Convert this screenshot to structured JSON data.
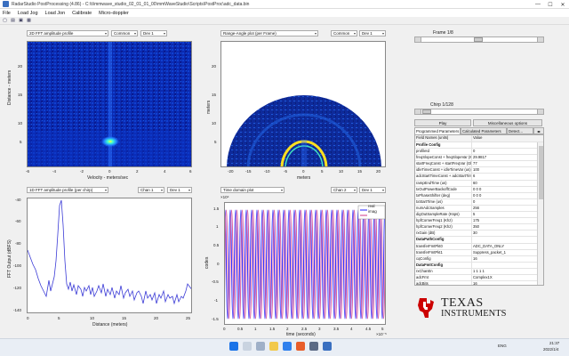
{
  "window": {
    "title": "RadarStudio PostProcessing (4.86) - C:\\ti\\mmwave_studio_02_01_01_00\\mmWaveStudio\\Scripts\\PostProc\\adc_data.bin"
  },
  "menu": [
    "File",
    "Load Jog",
    "Load Jon",
    "Calibrate",
    "Micro-doppler"
  ],
  "plots": {
    "doppler": {
      "title": "2D FFT amplitude profile",
      "sel2": "Common",
      "sel3": "Dev 1",
      "ylabel": "Distance - meters",
      "xlabel": "Velocity - meters/sec",
      "yticks": [
        "20",
        "15",
        "10",
        "5"
      ],
      "xticks": [
        "-6",
        "-4",
        "-2",
        "0",
        "2",
        "4",
        "6"
      ]
    },
    "range_angle": {
      "title": "Range-Angle plot (per Frame)",
      "sel2": "Common",
      "sel3": "Dev 1",
      "ylabel": "meters",
      "xlabel": "meters",
      "yticks": [
        "20",
        "15",
        "10",
        "5"
      ],
      "xticks": [
        "-20",
        "-15",
        "-10",
        "-5",
        "0",
        "5",
        "10",
        "15",
        "20"
      ]
    },
    "range_fft": {
      "title": "1D FFT amplitude profile (per chirp)",
      "sel2": "Chan 1",
      "sel3": "Dev 1",
      "ylabel": "FFT Output (dBFS)",
      "xlabel": "Distance (meters)",
      "yticks": [
        "-40",
        "-60",
        "-80",
        "-100",
        "-120",
        "-140"
      ],
      "xticks": [
        "0",
        "5",
        "10",
        "15",
        "20",
        "25"
      ]
    },
    "time_domain": {
      "title": "Time domain plot",
      "sel2": "Chan 2",
      "sel3": "Dev 1",
      "ylabel": "codes",
      "xlabel": "time (seconds)",
      "exp_y": "×10⁴",
      "exp_x": "×10⁻⁵",
      "yticks": [
        "1.5",
        "1",
        "0.5",
        "0",
        "-0.5",
        "-1",
        "-1.5"
      ],
      "xticks": [
        "0",
        "0.5",
        "1",
        "1.5",
        "2",
        "2.5",
        "3",
        "3.5",
        "4",
        "4.5",
        "5"
      ],
      "legend": [
        "real",
        "imag"
      ]
    }
  },
  "right_panel": {
    "frame_label": "Frame 1/8",
    "chirp_label": "Chirp 1/128",
    "play_label": "Play",
    "misc_label": "Miscellaneous options",
    "tabs": [
      "Programmed Parameters",
      "Calculated Parameters",
      "Detect..."
    ],
    "table_headers": [
      "Field Names    (units)",
      "Value"
    ],
    "rows": [
      {
        "k": "Profile Config",
        "v": "",
        "sec": true
      },
      {
        "k": "profileId",
        "v": "0"
      },
      {
        "k": "freqSlopeConst + freqSlopeVar (Mhz/us)",
        "v": "29.9817"
      },
      {
        "k": "startFreqConst + startFreqVar (Ghz)",
        "v": "77"
      },
      {
        "k": "idleTimeConst + idleTimeVar (us)",
        "v": "100"
      },
      {
        "k": "adcStartTimeConst + adcStartTimeVar (us)",
        "v": "6"
      },
      {
        "k": "rampEndTime (us)",
        "v": "60"
      },
      {
        "k": "txOutPowerBackoffCode",
        "v": "0 0 0"
      },
      {
        "k": "txPhaseShifter (deg)",
        "v": "0 0 0"
      },
      {
        "k": "txStartTime (us)",
        "v": "0"
      },
      {
        "k": "numAdcSamples",
        "v": "256"
      },
      {
        "k": "digOutSampleRate (Ksps)",
        "v": "5"
      },
      {
        "k": "hpfCornerFreq1 (Khz)",
        "v": "175"
      },
      {
        "k": "hpfCornerFreq2 (Khz)",
        "v": "350"
      },
      {
        "k": "rxGain (dB)",
        "v": "30"
      },
      {
        "k": "DataPathConfig",
        "v": "",
        "sec": true
      },
      {
        "k": "transferFmtPkt0",
        "v": "ADC_DATA_ONLY"
      },
      {
        "k": "transferFmtPkt1",
        "v": "Suppress_packet_1"
      },
      {
        "k": "cqConfig",
        "v": "16"
      },
      {
        "k": "DataFmtConfig",
        "v": "",
        "sec": true
      },
      {
        "k": "rxChanEn",
        "v": "1 1 1 1"
      },
      {
        "k": "adcFmt",
        "v": "Complex1X"
      },
      {
        "k": "adcBits",
        "v": "16"
      }
    ],
    "logo_line1": "TEXAS",
    "logo_line2": "INSTRUMENTS"
  },
  "taskbar": {
    "time": "21:37",
    "date": "2022/1/4",
    "lang": "ENG"
  },
  "colors": {
    "jet_dark": "#00008f",
    "jet_mid": "#0a3fd6",
    "line_blue": "#3b3bd6",
    "real": "#2020ff",
    "imag": "#d03a8a"
  }
}
